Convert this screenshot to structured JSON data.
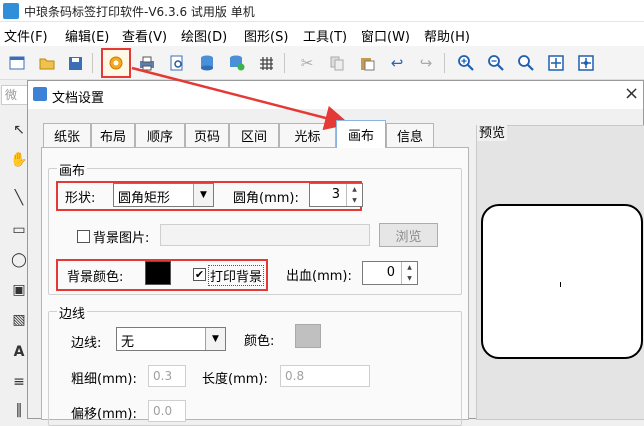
{
  "app": {
    "title": "中琅条码标签打印软件-V6.3.6 试用版 单机"
  },
  "menu": [
    {
      "label": "文件(F)"
    },
    {
      "label": "编辑(E)"
    },
    {
      "label": "查看(V)"
    },
    {
      "label": "绘图(D)"
    },
    {
      "label": "图形(S)"
    },
    {
      "label": "工具(T)"
    },
    {
      "label": "窗口(W)"
    },
    {
      "label": "帮助(H)"
    }
  ],
  "left_hint": "微",
  "dialog": {
    "title": "文档设置",
    "close": "×",
    "tabs": [
      "纸张",
      "布局",
      "顺序",
      "页码",
      "区间",
      "光标",
      "画布",
      "信息"
    ],
    "active_tab": "画布",
    "canvas_group": {
      "label": "画布",
      "shape_label": "形状:",
      "shape_value": "圆角矩形",
      "corner_label": "圆角(mm):",
      "corner_value": "3",
      "bg_image_label": "背景图片:",
      "browse_button": "浏览",
      "bg_color_label": "背景颜色:",
      "bg_color": "#000000",
      "print_bg_label": "打印背景",
      "print_bg_checked": "✔",
      "bleed_label": "出血(mm):",
      "bleed_value": "0"
    },
    "border_group": {
      "label": "边线",
      "border_label": "边线:",
      "border_value": "无",
      "color_label": "颜色:",
      "border_color": "#c0c0c0",
      "width_label": "粗细(mm):",
      "width_value": "0.3",
      "length_label": "长度(mm):",
      "length_value": "0.8",
      "offset_label": "偏移(mm):",
      "offset_value": "0.0"
    },
    "preview_label": "预览"
  },
  "colors": {
    "highlight": "#e53935",
    "arrow": "#e53935"
  }
}
